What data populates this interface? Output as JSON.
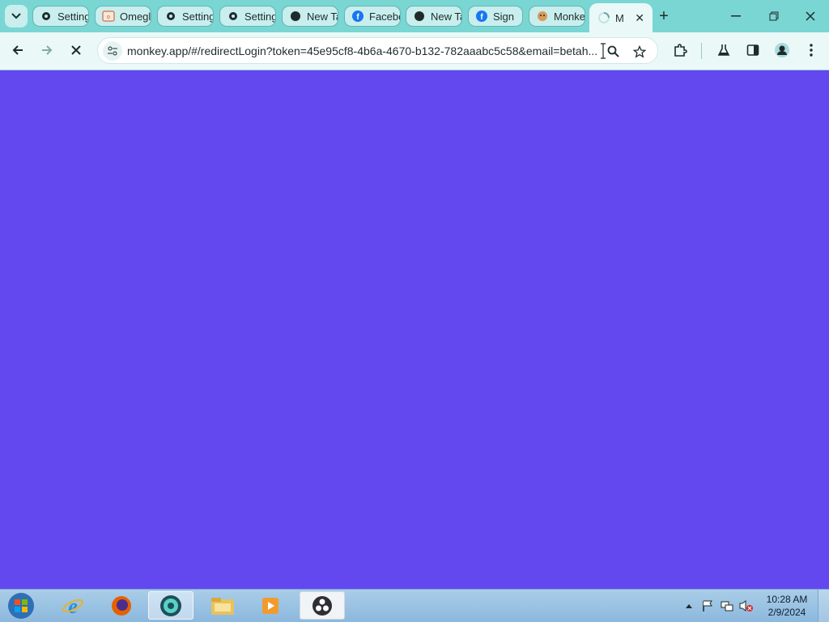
{
  "browser": {
    "tabs": [
      {
        "title": "Settings",
        "icon": "gear-icon"
      },
      {
        "title": "Omegle",
        "icon": "omegle-icon"
      },
      {
        "title": "Settings",
        "icon": "gear-icon"
      },
      {
        "title": "Settings",
        "icon": "gear-icon"
      },
      {
        "title": "New Tab",
        "icon": "chat-icon"
      },
      {
        "title": "Facebook",
        "icon": "facebook-icon"
      },
      {
        "title": "New Tab",
        "icon": "chat-icon"
      },
      {
        "title": "Sign",
        "icon": "facebook-icon"
      },
      {
        "title": "Monkey",
        "icon": "monkey-icon"
      }
    ],
    "active_tab": {
      "title": "M",
      "icon": "loading-spinner-icon"
    },
    "url": "monkey.app/#/redirectLogin?token=45e95cf8-4b6a-4670-b132-782aaabc5c58&email=betah...",
    "page_background": "#6348ef",
    "accent": "#7ad6d3"
  },
  "taskbar": {
    "apps": [
      {
        "name": "internet-explorer-icon"
      },
      {
        "name": "firefox-icon"
      },
      {
        "name": "chrome-icon"
      },
      {
        "name": "file-explorer-icon"
      },
      {
        "name": "media-player-icon"
      },
      {
        "name": "obs-icon"
      }
    ],
    "clock": {
      "time": "10:28 AM",
      "date": "2/9/2024"
    }
  }
}
